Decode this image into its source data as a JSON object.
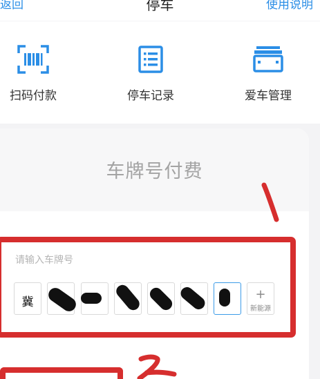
{
  "header": {
    "back_label": "返回",
    "title": "停车",
    "help_label": "使用说明"
  },
  "quick_actions": [
    {
      "label": "扫码付款",
      "icon": "barcode-scan-icon"
    },
    {
      "label": "停车记录",
      "icon": "record-list-icon"
    },
    {
      "label": "爱车管理",
      "icon": "car-manage-icon"
    }
  ],
  "panel": {
    "title": "车牌号付费"
  },
  "plate": {
    "placeholder": "请输入车牌号",
    "province": "冀",
    "new_energy_symbol": "+",
    "new_energy_label": "新能源"
  },
  "colors": {
    "accent": "#2b8ee6",
    "annotation_red": "#d62e2e",
    "active_border": "#3b9be8"
  }
}
